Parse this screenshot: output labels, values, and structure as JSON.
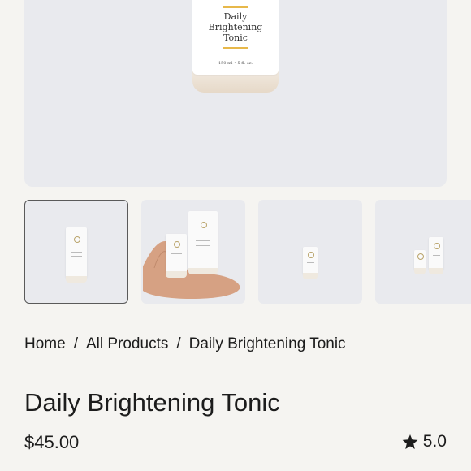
{
  "hero": {
    "product_label": [
      "Daily",
      "Brightening",
      "Tonic"
    ],
    "size_text": "150 ml  •  5 fl. oz."
  },
  "thumbnails": [
    {
      "alt": "Single bottle on grey background",
      "active": true
    },
    {
      "alt": "Hand holding two bottles",
      "active": false
    },
    {
      "alt": "Small bottle on grey background",
      "active": false
    },
    {
      "alt": "Two bottles on grey background",
      "active": false
    }
  ],
  "breadcrumb": {
    "items": [
      "Home",
      "All Products",
      "Daily Brightening Tonic"
    ],
    "separator": "/"
  },
  "product": {
    "title": "Daily Brightening Tonic",
    "price": "$45.00",
    "rating": "5.0",
    "rating_icon": "star-icon"
  },
  "colors": {
    "background": "#f5f4f1",
    "image_bg": "#e9eaee",
    "text": "#1c1c1c",
    "accent_gold": "#e7b84a"
  }
}
